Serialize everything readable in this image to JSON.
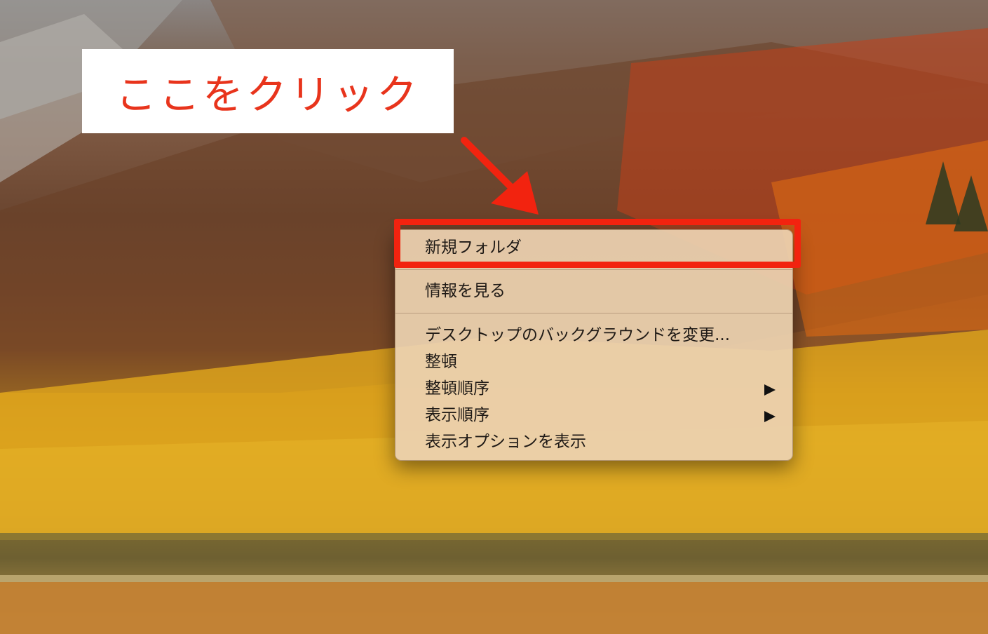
{
  "annotation": {
    "callout_text": "ここをクリック",
    "accent_color": "#f2230f"
  },
  "context_menu": {
    "items": [
      {
        "label": "新規フォルダ",
        "submenu": false
      },
      {
        "label": "情報を見る",
        "submenu": false
      },
      {
        "label": "デスクトップのバックグラウンドを変更...",
        "submenu": false
      },
      {
        "label": "整頓",
        "submenu": false
      },
      {
        "label": "整頓順序",
        "submenu": true
      },
      {
        "label": "表示順序",
        "submenu": true
      },
      {
        "label": "表示オプションを表示",
        "submenu": false
      }
    ]
  },
  "icons": {
    "submenu_arrow": "chevron-right-icon",
    "callout_arrow": "annotation-arrow-icon"
  }
}
